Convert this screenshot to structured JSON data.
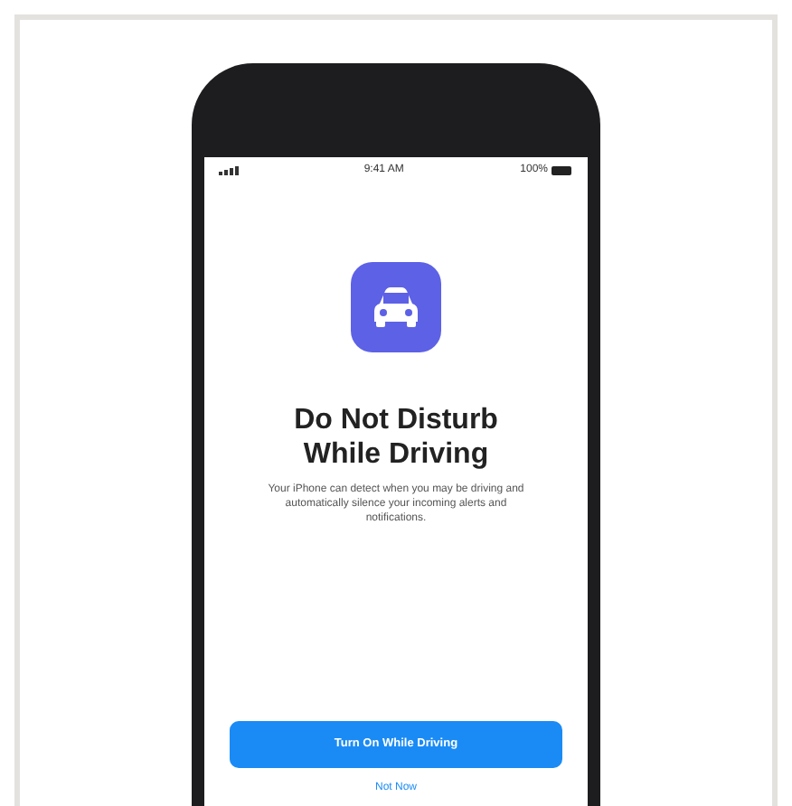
{
  "status_bar": {
    "time": "9:41 AM",
    "battery": "100%"
  },
  "title": "Do Not Disturb While Driving",
  "description": "Your iPhone can detect when you may be driving and automatically silence your incoming alerts and notifications.",
  "primary_button": "Turn On While Driving",
  "secondary_button": "Not Now"
}
